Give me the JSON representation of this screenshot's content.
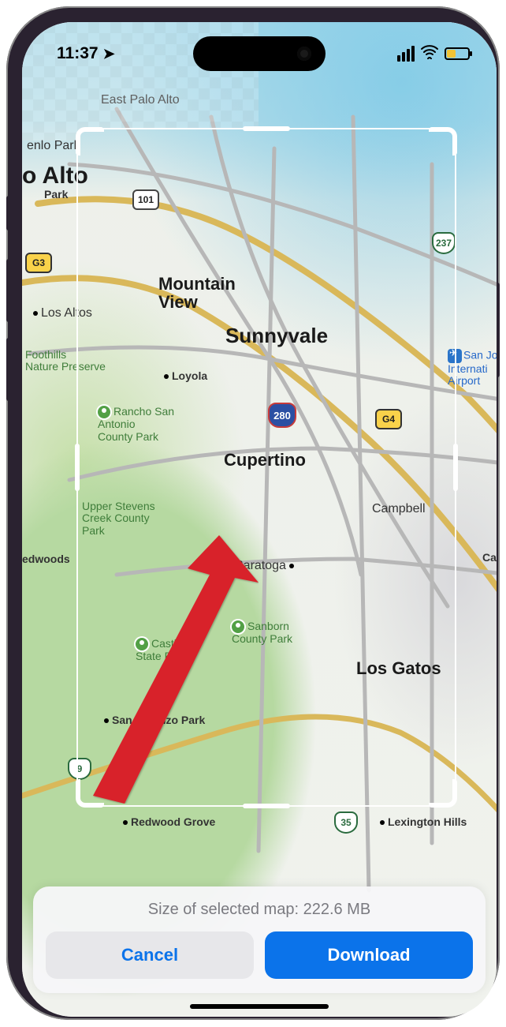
{
  "status": {
    "time": "11:37",
    "location_icon": "location-arrow",
    "cellular_bars": 4,
    "wifi": true,
    "battery_level_percent_est": 30,
    "battery_low_power_mode": true
  },
  "map": {
    "cities_major": [
      "Sunnyvale"
    ],
    "cities": {
      "east_palo_alto": "East Palo Alto",
      "palo_alto_area": "o Alto",
      "palo_alto_park": "Park",
      "menlo_park": "enlo Park",
      "mountain_view": "Mountain\nView",
      "sunnyvale": "Sunnyvale",
      "los_altos": "Los Altos",
      "loyola": "Loyola",
      "cupertino": "Cupertino",
      "campbell": "Campbell",
      "saratoga": "Saratoga",
      "los_gatos": "Los Gatos",
      "san_lorenzo_park": "San Lorenzo Park",
      "redwood_grove": "Redwood Grove",
      "lexington_hills": "Lexington Hills",
      "redwood_truncated": "edwoods",
      "ca_truncated": "Ca"
    },
    "parks": {
      "foothills": "Foothills\nNature Preserve",
      "rancho": "Rancho San\nAntonio\nCounty Park",
      "upper_stevens": "Upper Stevens\nCreek County\nPark",
      "castle_rock": "Castle Ro\nState Pa",
      "sanborn": "Sanborn\nCounty Park"
    },
    "airport": "San José\nInternati\nAirport",
    "shields": {
      "us101": "101",
      "i280": "280",
      "ca9": "9",
      "ca35": "35",
      "ca237": "237",
      "g3": "G3",
      "g4": "G4"
    }
  },
  "sheet": {
    "size_prefix": "Size of selected map: ",
    "size_value": "222.6 MB",
    "cancel_label": "Cancel",
    "download_label": "Download"
  }
}
